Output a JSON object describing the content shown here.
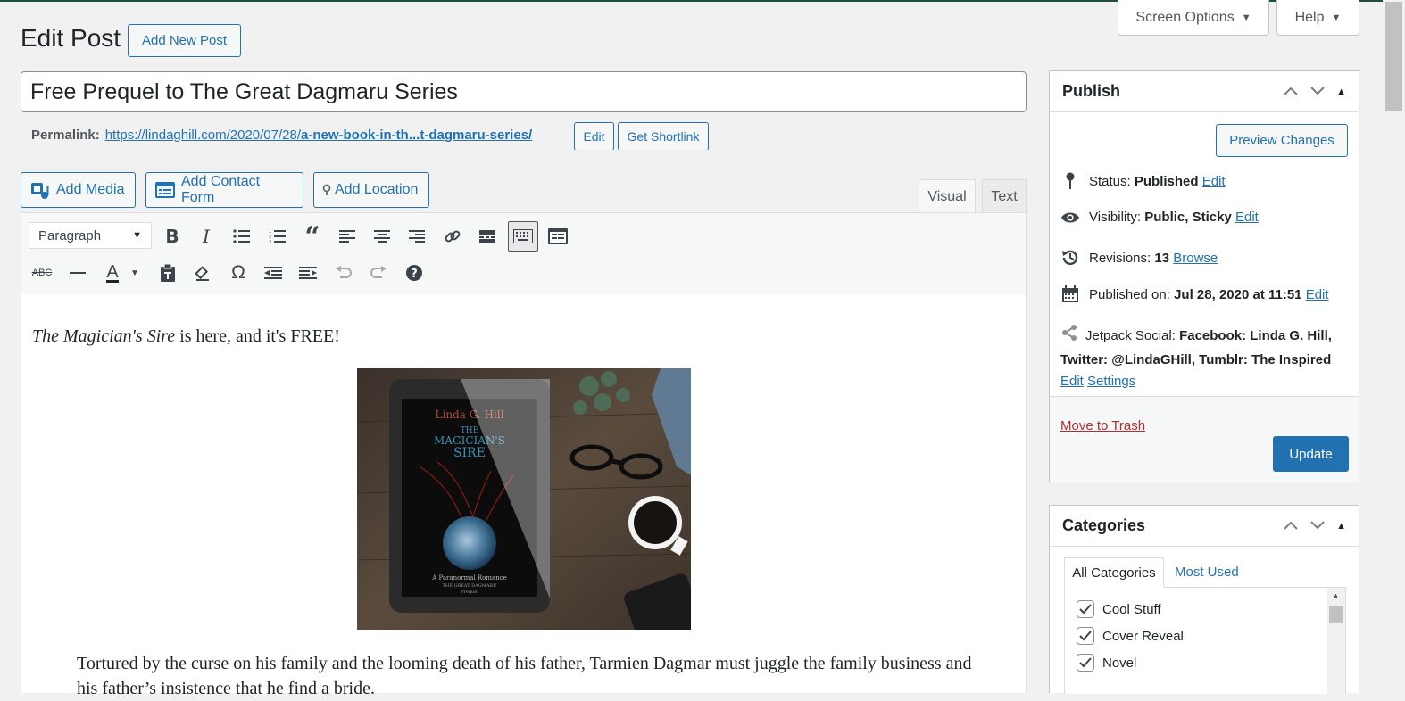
{
  "screen_meta": {
    "screen_options": "Screen Options",
    "help": "Help"
  },
  "page": {
    "title": "Edit Post",
    "add_new": "Add New Post"
  },
  "post": {
    "title": "Free Prequel to The Great Dagmaru Series",
    "permalink_label": "Permalink:",
    "permalink_base": "https://lindaghill.com/2020/07/28/",
    "permalink_slug": "a-new-book-in-th...t-dagmaru-series/",
    "edit_btn": "Edit",
    "shortlink_btn": "Get Shortlink"
  },
  "media_buttons": {
    "add_media": "Add Media",
    "add_contact_form": "Add Contact Form",
    "add_location": "Add Location"
  },
  "editor_tabs": {
    "visual": "Visual",
    "text": "Text"
  },
  "toolbar": {
    "format": "Paragraph",
    "text_color_letter": "A"
  },
  "content": {
    "intro_italic": "The Magician's Sire",
    "intro_rest": " is here, and it's FREE!",
    "paragraph": "Tortured by the curse on his family and the looming death of his father, Tarmien Dagmar must juggle the family business and his father’s insistence that he find a bride.",
    "cover": {
      "author": "Linda G. Hill",
      "title_line1": "THE",
      "title_line2": "MAGICIAN'S",
      "title_line3": "SIRE",
      "subtitle": "A Paranormal Romance",
      "series": "THE GREAT DAGMARU",
      "tag": "Prequel"
    }
  },
  "publish": {
    "heading": "Publish",
    "preview": "Preview Changes",
    "status_label": "Status:",
    "status_value": "Published",
    "visibility_label": "Visibility:",
    "visibility_value": "Public, Sticky",
    "revisions_label": "Revisions:",
    "revisions_value": "13",
    "browse": "Browse",
    "published_label": "Published on:",
    "published_value": "Jul 28, 2020 at 11:51",
    "edit": "Edit",
    "jetpack_label": "Jetpack Social:",
    "jetpack_line1_value": "Facebook: Linda G. Hill,",
    "jetpack_line2_value": "Twitter: @LindaGHill, Tumblr: The Inspired",
    "settings": "Settings",
    "trash": "Move to Trash",
    "update": "Update"
  },
  "categories": {
    "heading": "Categories",
    "tab_all": "All Categories",
    "tab_most": "Most Used",
    "items": [
      {
        "label": "Cool Stuff",
        "checked": true
      },
      {
        "label": "Cover Reveal",
        "checked": true
      },
      {
        "label": "Novel",
        "checked": true
      }
    ]
  }
}
